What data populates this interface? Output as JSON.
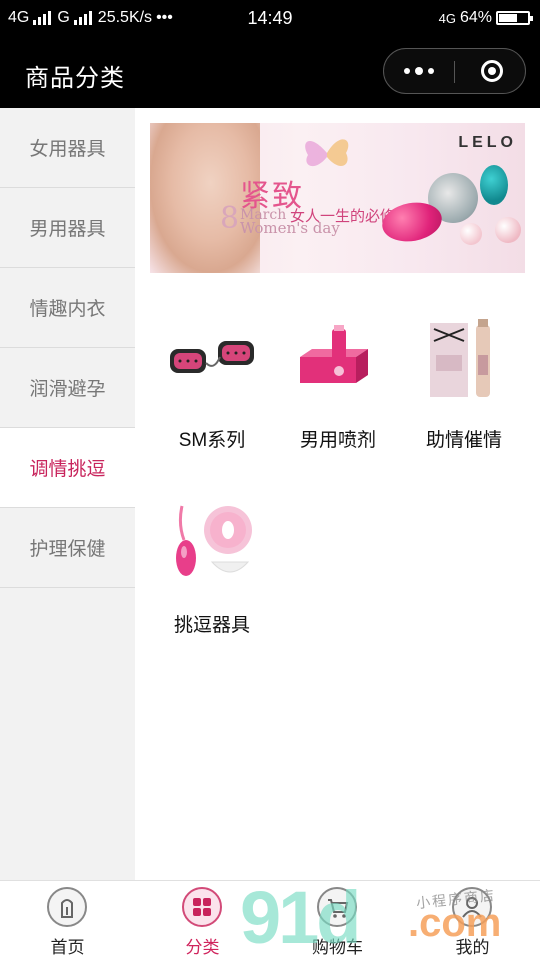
{
  "status_bar": {
    "network1": "4G",
    "network2": "G",
    "speed": "25.5K/s",
    "dots": "•••",
    "time": "14:49",
    "network3": "4G",
    "battery": "64%",
    "battery_level": 0.64
  },
  "navbar": {
    "title": "商品分类"
  },
  "sidebar": {
    "items": [
      {
        "label": "女用器具"
      },
      {
        "label": "男用器具"
      },
      {
        "label": "情趣内衣"
      },
      {
        "label": "润滑避孕"
      },
      {
        "label": "调情挑逗"
      },
      {
        "label": "护理保健"
      }
    ],
    "active_index": 4
  },
  "banner": {
    "brand": "LELO",
    "headline": "紧致",
    "number": "8",
    "march": "March",
    "slogan": "女人一生的必修课",
    "womens_day": "Women's day"
  },
  "products": [
    {
      "label": "SM系列"
    },
    {
      "label": "男用喷剂"
    },
    {
      "label": "助情催情"
    },
    {
      "label": "挑逗器具"
    }
  ],
  "tabbar": {
    "tabs": [
      {
        "label": "首页",
        "icon": "home-icon"
      },
      {
        "label": "分类",
        "icon": "category-icon"
      },
      {
        "label": "购物车",
        "icon": "cart-icon"
      },
      {
        "label": "我的",
        "icon": "profile-icon"
      }
    ],
    "active_index": 1
  },
  "watermark": {
    "number": "91d",
    "domain": ".com",
    "handwriting": "小程序商店"
  },
  "colors": {
    "accent": "#c8245c",
    "header_bg": "#000000",
    "sidebar_bg": "#f2f2f2"
  }
}
